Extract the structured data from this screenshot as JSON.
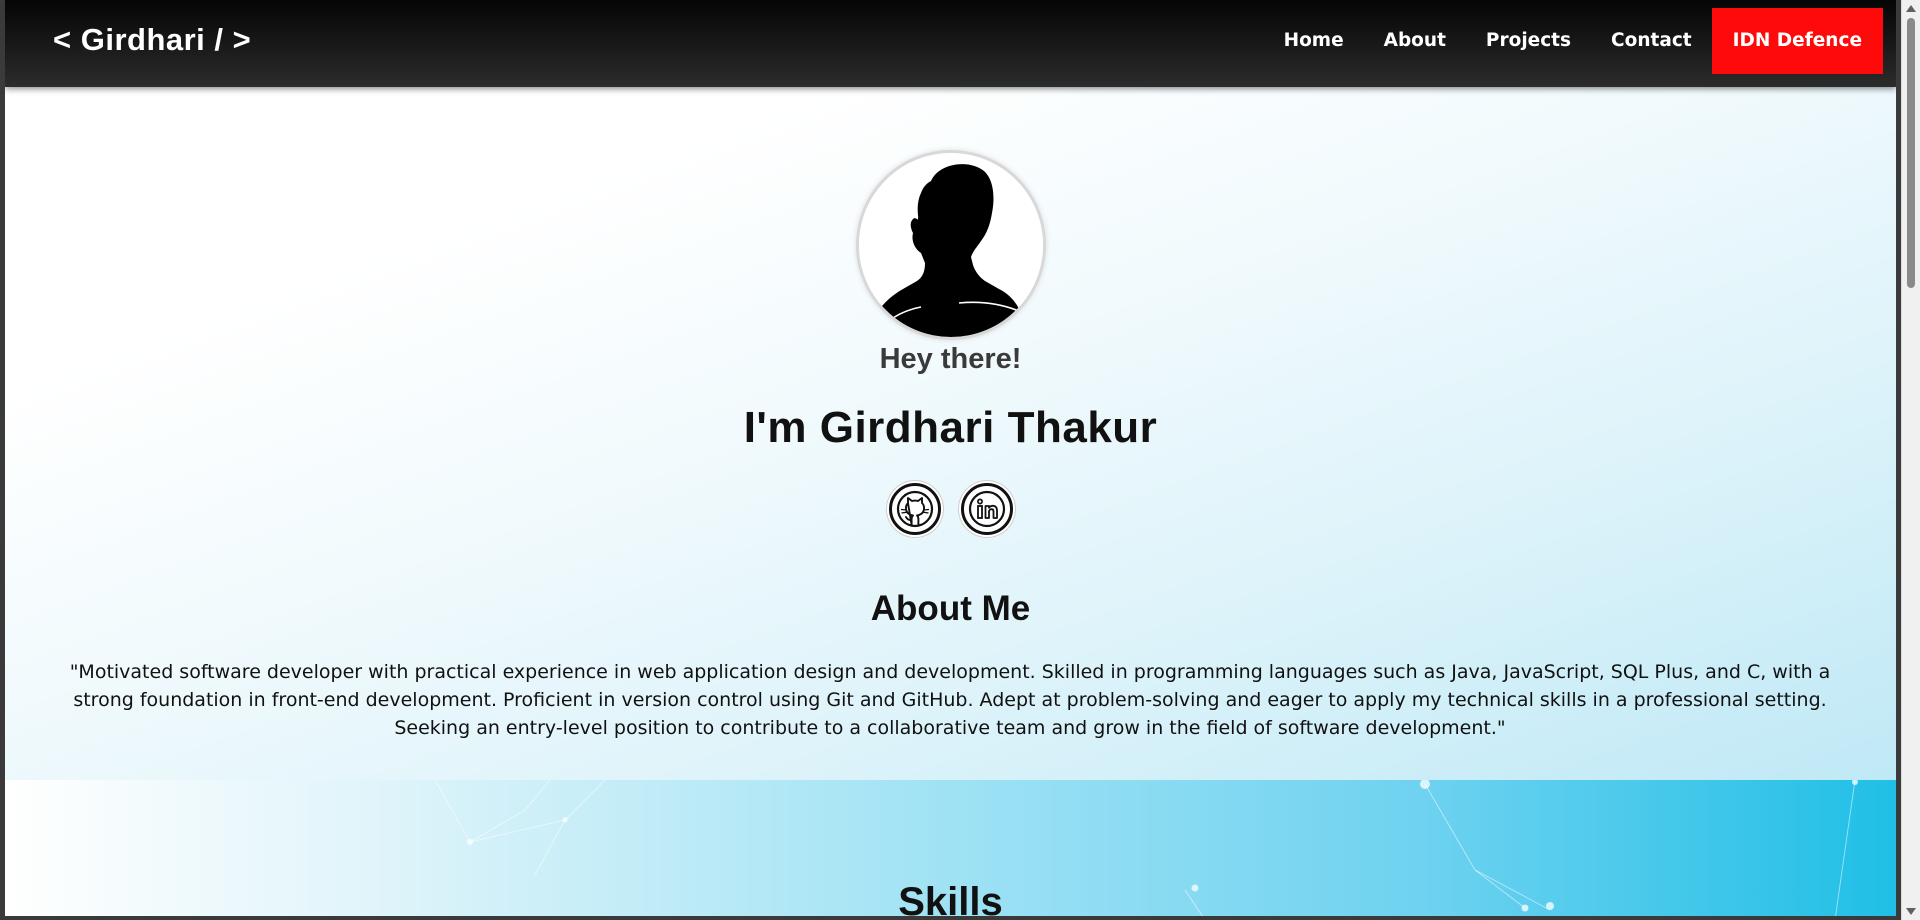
{
  "navbar": {
    "logo": "< Girdhari / >",
    "links": [
      "Home",
      "About",
      "Projects",
      "Contact"
    ],
    "cta": "IDN Defence",
    "cta_color": "#ff0a0a"
  },
  "hero": {
    "avatar_icon": "person-silhouette-avatar",
    "greeting": "Hey there!",
    "name": "I'm Girdhari Thakur",
    "socials": [
      {
        "icon": "github-icon"
      },
      {
        "icon": "linkedin-icon"
      }
    ]
  },
  "about": {
    "title": "About Me",
    "text": "\"Motivated software developer with practical experience in web application design and development. Skilled in programming languages such as Java, JavaScript, SQL Plus, and C, with a strong foundation in front-end development. Proficient in version control using Git and GitHub. Adept at problem-solving and eager to apply my technical skills in a professional setting. Seeking an entry-level position to contribute to a collaborative team and grow in the field of software development.\""
  },
  "skills": {
    "title": "Skills",
    "accent": "#20bfe6"
  }
}
